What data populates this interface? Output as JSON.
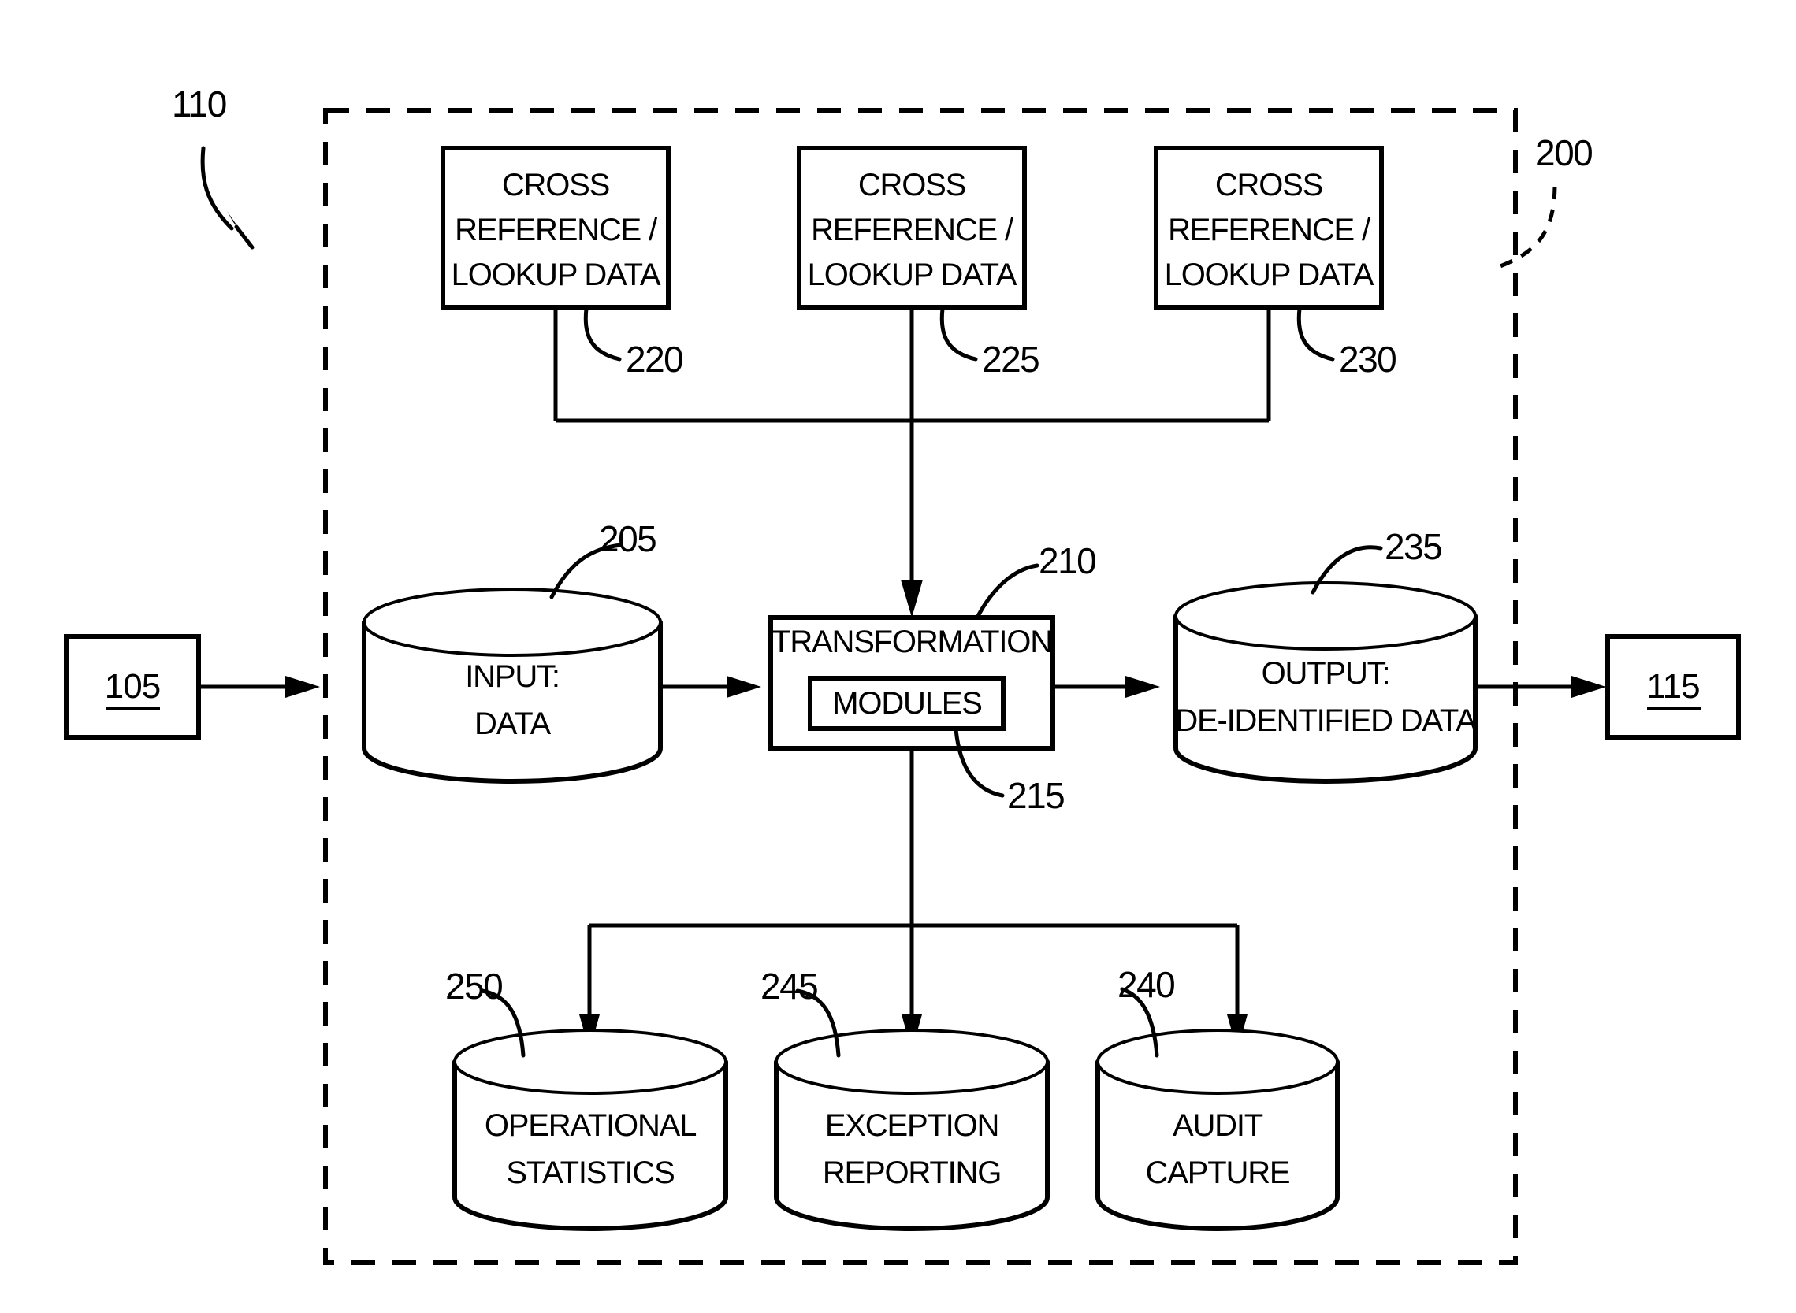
{
  "figure": {
    "domain": "patent-block-diagram",
    "boundary_label": "200"
  },
  "system_ref": {
    "label": "110"
  },
  "ports": {
    "input_source": {
      "label": "105"
    },
    "output_sink": {
      "label": "115"
    }
  },
  "lookup_boxes": [
    {
      "line1": "CROSS",
      "line2": "REFERENCE /",
      "line3": "LOOKUP DATA",
      "ref": "220"
    },
    {
      "line1": "CROSS",
      "line2": "REFERENCE /",
      "line3": "LOOKUP DATA",
      "ref": "225"
    },
    {
      "line1": "CROSS",
      "line2": "REFERENCE /",
      "line3": "LOOKUP DATA",
      "ref": "230"
    }
  ],
  "input_store": {
    "line1": "INPUT:",
    "line2": "DATA",
    "ref": "205"
  },
  "transformation": {
    "title": "TRANSFORMATION",
    "modules_label": "MODULES",
    "ref": "210",
    "modules_ref": "215"
  },
  "output_store": {
    "line1": "OUTPUT:",
    "line2": "DE-IDENTIFIED DATA",
    "ref": "235"
  },
  "log_stores": [
    {
      "line1": "OPERATIONAL",
      "line2": "STATISTICS",
      "ref": "250"
    },
    {
      "line1": "EXCEPTION",
      "line2": "REPORTING",
      "ref": "245"
    },
    {
      "line1": "AUDIT",
      "line2": "CAPTURE",
      "ref": "240"
    }
  ],
  "colors": {
    "stroke": "#000000",
    "fill": "#ffffff"
  }
}
